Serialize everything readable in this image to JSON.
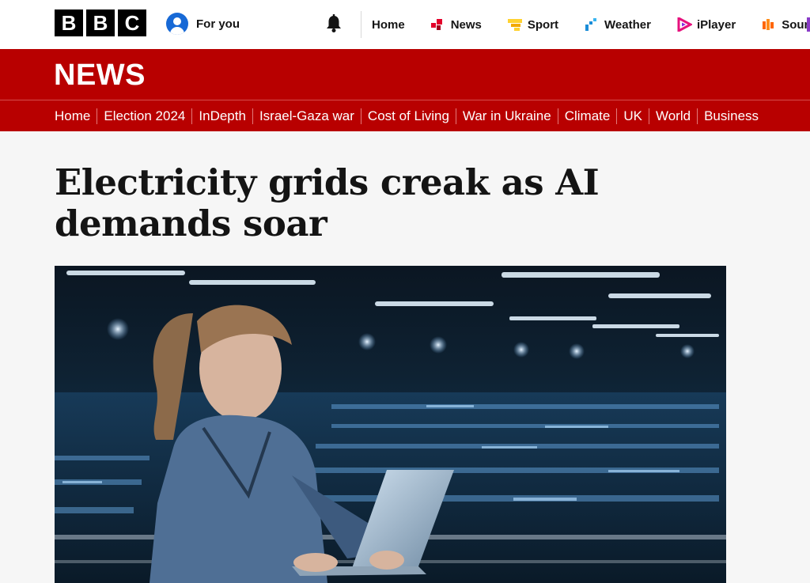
{
  "brand": {
    "letters": [
      "B",
      "B",
      "C"
    ]
  },
  "account": {
    "label": "For you",
    "icon": "user-icon"
  },
  "notifications": {
    "icon": "bell-icon"
  },
  "top_nav": [
    {
      "label": "Home",
      "icon": ""
    },
    {
      "label": "News",
      "icon": "news-icon",
      "color": "#e4002b"
    },
    {
      "label": "Sport",
      "icon": "sport-icon",
      "color": "#ffd230"
    },
    {
      "label": "Weather",
      "icon": "weather-icon",
      "color": "#1b8dd8"
    },
    {
      "label": "iPlayer",
      "icon": "iplayer-icon",
      "color": "#e6117d"
    },
    {
      "label": "Sounds",
      "icon": "sounds-icon",
      "color": "#ff6600"
    }
  ],
  "banner": {
    "title": "NEWS",
    "color": "#b80000",
    "sections": [
      "Home",
      "Election 2024",
      "InDepth",
      "Israel-Gaza war",
      "Cost of Living",
      "War in Ukraine",
      "Climate",
      "UK",
      "World",
      "Business"
    ]
  },
  "article": {
    "headline": "Electricity grids creak as AI demands soar",
    "image": "woman-with-laptop-in-data-center"
  }
}
